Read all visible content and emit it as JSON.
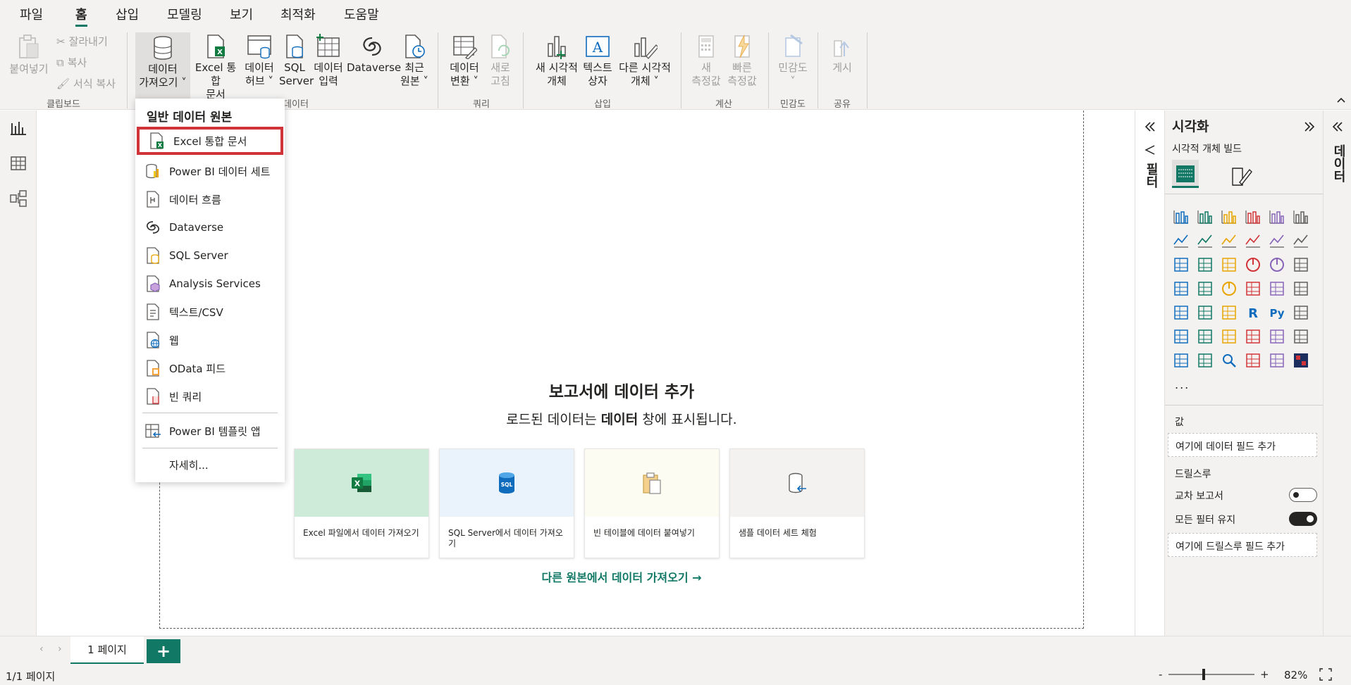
{
  "menu": {
    "tabs": [
      "파일",
      "홈",
      "삽입",
      "모델링",
      "보기",
      "최적화",
      "도움말"
    ],
    "active": "홈"
  },
  "ribbon": {
    "clipboard": {
      "paste": "붙여넣기",
      "cut": "잘라내기",
      "copy": "복사",
      "format_painter": "서식 복사",
      "group": "클립보드"
    },
    "data": {
      "get_data": [
        "데이터",
        "가져오기"
      ],
      "excel": [
        "Excel 통합",
        "문서"
      ],
      "data_hub": [
        "데이터",
        "허브"
      ],
      "sql": [
        "SQL",
        "Server"
      ],
      "enter_data": [
        "데이터",
        "입력"
      ],
      "dataverse": "Dataverse",
      "recent": [
        "최근",
        "원본"
      ],
      "group": "데이터"
    },
    "queries": {
      "transform": [
        "데이터",
        "변환"
      ],
      "refresh": [
        "새로",
        "고침"
      ],
      "group": "쿼리"
    },
    "insert": {
      "new_visual": [
        "새 시각적",
        "개체"
      ],
      "textbox": [
        "텍스트",
        "상자"
      ],
      "more_visuals": [
        "다른 시각적",
        "개체"
      ],
      "group": "삽입"
    },
    "calc": {
      "new_measure": [
        "새",
        "측정값"
      ],
      "quick_measure": [
        "빠른",
        "측정값"
      ],
      "group": "계산"
    },
    "sensitivity": {
      "label": "민감도",
      "group": "민감도"
    },
    "share": {
      "publish": "게시",
      "group": "공유"
    }
  },
  "dropdown": {
    "header": "일반 데이터 원본",
    "items": [
      {
        "label": "Excel 통합 문서",
        "icon": "excel-icon"
      },
      {
        "label": "Power BI 데이터 세트",
        "icon": "powerbi-dataset-icon"
      },
      {
        "label": "데이터 흐름",
        "icon": "dataflow-icon"
      },
      {
        "label": "Dataverse",
        "icon": "dataverse-icon"
      },
      {
        "label": "SQL Server",
        "icon": "sql-server-icon"
      },
      {
        "label": "Analysis Services",
        "icon": "analysis-services-icon"
      },
      {
        "label": "텍스트/CSV",
        "icon": "text-csv-icon"
      },
      {
        "label": "웹",
        "icon": "web-icon"
      },
      {
        "label": "OData 피드",
        "icon": "odata-icon"
      },
      {
        "label": "빈 쿼리",
        "icon": "blank-query-icon"
      }
    ],
    "template_app": "Power BI 템플릿 앱",
    "more": "자세히..."
  },
  "welcome": {
    "title": "보고서에 데이터 추가",
    "sub_before": "로드된 데이터는 ",
    "sub_bold": "데이터",
    "sub_after": " 창에 표시됩니다.",
    "cards": [
      {
        "label": "Excel 파일에서 데이터 가져오기",
        "bg": "#cdebd8"
      },
      {
        "label": "SQL Server에서 데이터 가져오기",
        "bg": "#eaf3fb"
      },
      {
        "label": "빈 테이블에 데이터 붙여넣기",
        "bg": "#fcfcf3"
      },
      {
        "label": "샘플 데이터 세트 체험",
        "bg": "#f3f2f1"
      }
    ],
    "more_link": "다른 원본에서 데이터 가져오기 →"
  },
  "filters_pane": {
    "label": "필터"
  },
  "viz_pane": {
    "title": "시각화",
    "subtitle": "시각적 개체 빌드",
    "values_label": "값",
    "values_well": "여기에 데이터 필드 추가",
    "drillthrough_label": "드릴스루",
    "cross_report": "교차 보고서",
    "keep_filters": "모든 필터 유지",
    "drill_well": "여기에 드릴스루 필드 추가",
    "more": "..."
  },
  "data_pane": {
    "label": "데이터"
  },
  "pages": {
    "tab": "1 페이지",
    "add": "+"
  },
  "status": {
    "page": "1/1 페이지",
    "zoom": "82%",
    "zoom_level": 0.82
  },
  "colors": {
    "accent": "#117865",
    "highlight": "#d13438",
    "excel_green": "#107c41",
    "sql_blue": "#0f6cbd"
  }
}
